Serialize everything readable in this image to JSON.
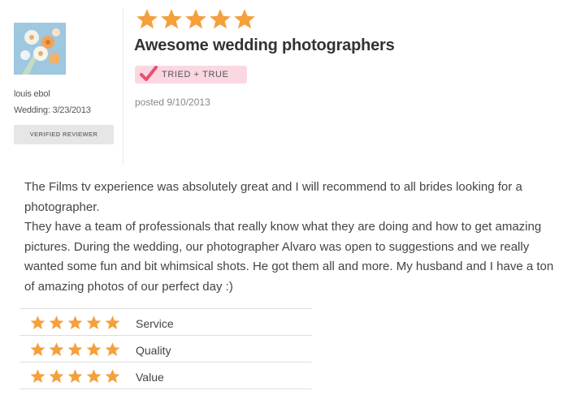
{
  "reviewer": {
    "name": "louis ebol",
    "wedding": "Wedding: 3/23/2013",
    "verified_label": "VERIFIED REVIEWER"
  },
  "review": {
    "overall_rating": 5,
    "overall_max": 5,
    "title": "Awesome wedding photographers",
    "badge": "TRIED + TRUE",
    "posted": "posted 9/10/2013",
    "paragraphs": [
      "The Films tv experience was absolutely great and I will recommend to all brides looking for a photographer.",
      "They have a team of professionals that really know what they are doing and how to get amazing pictures. During the wedding, our photographer Alvaro was open to suggestions and we really wanted some fun and bit whimsical shots. He got them all and more. My husband and I have a ton of amazing photos of our perfect day :)"
    ]
  },
  "subratings": [
    {
      "label": "Service",
      "rating": 5
    },
    {
      "label": "Quality",
      "rating": 5
    },
    {
      "label": "Value",
      "rating": 5
    }
  ],
  "colors": {
    "star": "#f5a03c",
    "badge_bg": "#fbd7e2",
    "badge_check": "#e8506e"
  },
  "icons": {
    "star": "star-icon",
    "check": "checkmark-icon"
  }
}
